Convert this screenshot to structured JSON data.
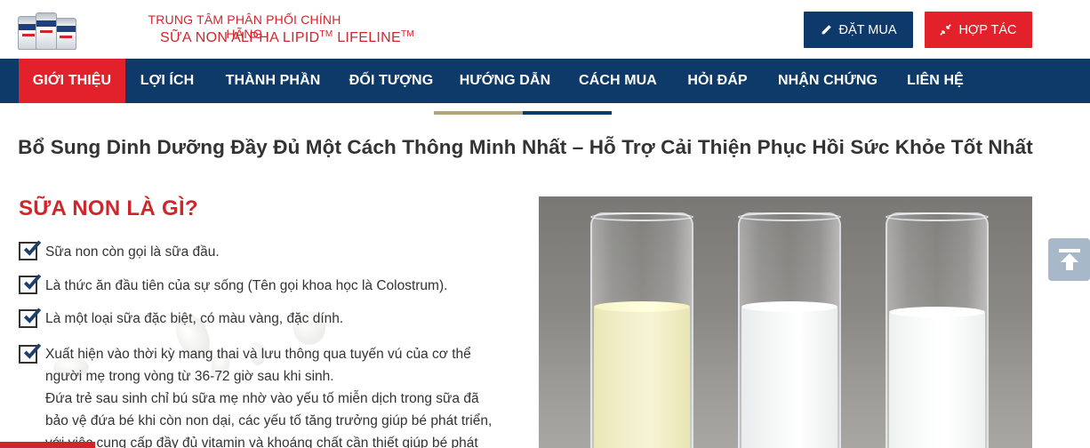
{
  "header": {
    "logo_icon": "milk-cans-logo",
    "brand_top": "TRUNG TÂM PHÂN PHỐI CHÍNH HÃNG",
    "brand_main_part1": "SỮA NON ALPHA LIPID",
    "brand_tm1": "TM",
    "brand_main_part2": " LIFELINE",
    "brand_tm2": "TM",
    "order_button": "ĐẶT MUA",
    "order_icon": "pencil-icon",
    "cooperate_button": "HỢP TÁC",
    "cooperate_icon": "compress-arrows-icon"
  },
  "nav": {
    "items": [
      "GIỚI THIỆU",
      "LỢI ÍCH",
      "THÀNH PHẦN",
      "ĐỐI TƯỢNG",
      "HƯỚNG DẪN",
      "CÁCH MUA",
      "HỎI ĐÁP",
      "NHẬN CHỨNG",
      "LIÊN HỆ"
    ],
    "active": "GIỚI THIỆU"
  },
  "main": {
    "headline": "Bổ Sung Dinh Dưỡng Đầy Đủ Một Cách Thông Minh Nhất – Hỗ Trợ Cải Thiện Phục Hồi Sức Khỏe Tốt Nhất",
    "section_title": "SỮA NON LÀ GÌ?",
    "items": [
      [
        "Sữa non còn gọi là sữa đầu."
      ],
      [
        "Là thức ăn đầu tiên của sự sống (Tên gọi khoa học là Colostrum)."
      ],
      [
        "Là một loại sữa đặc biệt, có màu vàng, đặc dính."
      ],
      [
        "Xuất hiện vào thời kỳ mang thai và lưu thông qua tuyến vú của cơ thể",
        "người mẹ trong vòng từ 36-72 giờ sau khi sinh.",
        "Đứa trẻ sau sinh chỉ bú sữa mẹ nhờ vào yếu tố miễn dịch trong sữa đã",
        "bảo vệ đứa bé khi còn non dại, các yếu tố tăng trưởng giúp bé phát triển,",
        "với việc cung cấp đầy đủ vitamin và khoáng chất cần thiết giúp bé phát"
      ]
    ],
    "photo_icon": "colostrum-test-tubes-photo"
  },
  "scroll_top_icon": "scroll-to-top-icon",
  "colors": {
    "brand_red": "#e3212b",
    "brand_navy": "#0d3a68",
    "gold": "#b5a57c"
  }
}
